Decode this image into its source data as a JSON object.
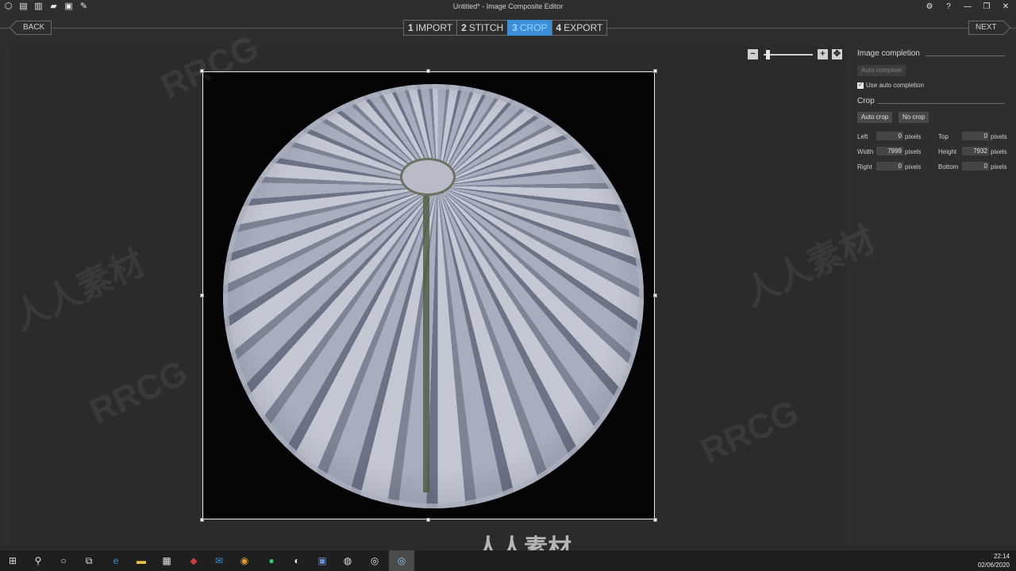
{
  "window": {
    "title": "Untitled* - Image Composite Editor",
    "toolbar_icons": [
      "new-panorama-icon",
      "new-from-video-icon",
      "new-composite-icon",
      "open-icon",
      "save-icon",
      "export-icon"
    ],
    "controls": [
      "gear-icon",
      "help-icon",
      "minimize-icon",
      "maximize-icon",
      "close-icon"
    ]
  },
  "nav": {
    "back_label": "BACK",
    "next_label": "NEXT",
    "steps": [
      {
        "num": "1",
        "label": "IMPORT"
      },
      {
        "num": "2",
        "label": "STITCH"
      },
      {
        "num": "3",
        "label": "CROP"
      },
      {
        "num": "4",
        "label": "EXPORT"
      }
    ],
    "active_step": 3
  },
  "zoom": {
    "minus": "−",
    "plus": "+",
    "level": 0.05
  },
  "panel": {
    "completion_heading": "Image completion",
    "auto_complete_label": "Auto complete",
    "use_auto_completion_label": "Use auto completion",
    "use_auto_completion_checked": true,
    "crop_heading": "Crop",
    "auto_crop_label": "Auto crop",
    "no_crop_label": "No crop",
    "fields": {
      "left": {
        "label": "Left",
        "value": "0",
        "unit": "pixels"
      },
      "top": {
        "label": "Top",
        "value": "0",
        "unit": "pixels"
      },
      "width": {
        "label": "Width",
        "value": "7999",
        "unit": "pixels"
      },
      "height": {
        "label": "Height",
        "value": "7932",
        "unit": "pixels"
      },
      "right": {
        "label": "Right",
        "value": "0",
        "unit": "pixels"
      },
      "bottom": {
        "label": "Bottom",
        "value": "0",
        "unit": "pixels"
      }
    }
  },
  "watermarks": [
    "RRCG",
    "人人素材"
  ],
  "taskbar": {
    "time": "22:14",
    "date": "02/06/2020",
    "apps": [
      "start-icon",
      "search-icon",
      "cortana-icon",
      "task-view-icon",
      "edge-icon",
      "explorer-icon",
      "store-icon",
      "app-icon",
      "mail-icon",
      "chrome-icon",
      "spotify-icon",
      "app-icon",
      "app-icon",
      "app-icon",
      "app-icon",
      "ice-icon"
    ]
  },
  "colors": {
    "accent": "#3a8fd8",
    "background": "#2b2b2b",
    "panel": "#2e2e2e"
  }
}
